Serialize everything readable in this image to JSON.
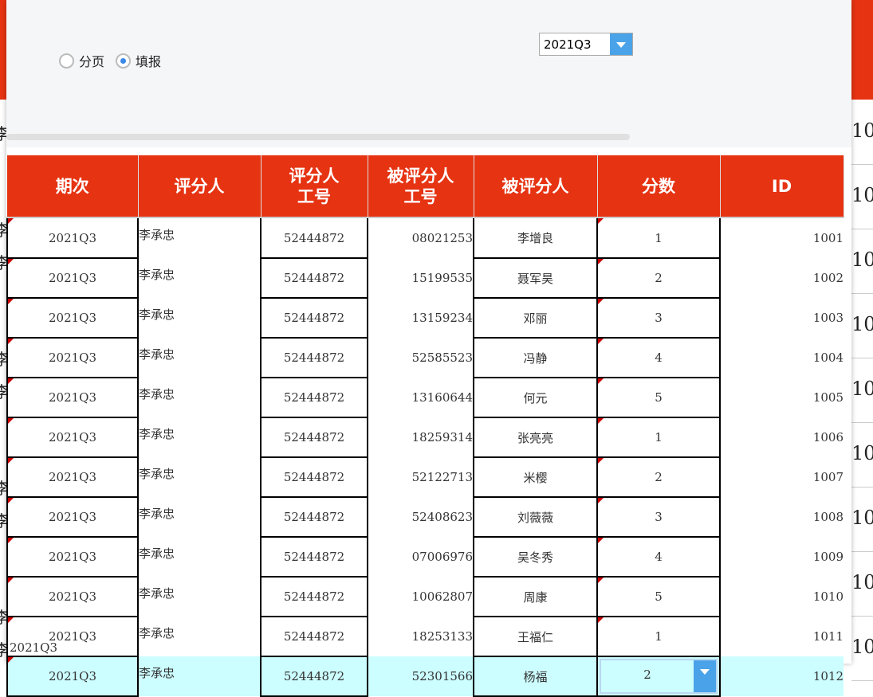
{
  "filters": {
    "radio_paging": "分页",
    "radio_fill": "填报",
    "selected": "fill",
    "period_select": "2021Q3"
  },
  "columns": [
    "期次",
    "评分人",
    "评分人\n工号",
    "被评分人\n工号",
    "被评分人",
    "分数",
    "ID"
  ],
  "rows": [
    [
      "2021Q3",
      "李承忠",
      "52444872",
      "08021253",
      "李增良",
      "1",
      "1001"
    ],
    [
      "2021Q3",
      "李承忠",
      "52444872",
      "15199535",
      "聂军昊",
      "2",
      "1002"
    ],
    [
      "2021Q3",
      "李承忠",
      "52444872",
      "13159234",
      "邓丽",
      "3",
      "1003"
    ],
    [
      "2021Q3",
      "李承忠",
      "52444872",
      "52585523",
      "冯静",
      "4",
      "1004"
    ],
    [
      "2021Q3",
      "李承忠",
      "52444872",
      "13160644",
      "何元",
      "5",
      "1005"
    ],
    [
      "2021Q3",
      "李承忠",
      "52444872",
      "18259314",
      "张亮亮",
      "1",
      "1006"
    ],
    [
      "2021Q3",
      "李承忠",
      "52444872",
      "52122713",
      "米樱",
      "2",
      "1007"
    ],
    [
      "2021Q3",
      "李承忠",
      "52444872",
      "52408623",
      "刘薇薇",
      "3",
      "1008"
    ],
    [
      "2021Q3",
      "李承忠",
      "52444872",
      "07006976",
      "吴冬秀",
      "4",
      "1009"
    ],
    [
      "2021Q3",
      "李承忠",
      "52444872",
      "10062807",
      "周康",
      "5",
      "1010"
    ],
    [
      "2021Q3",
      "李承忠",
      "52444872",
      "18253133",
      "王福仁",
      "1",
      "1011"
    ],
    [
      "2021Q3",
      "李承忠",
      "52444872",
      "52301566",
      "杨福",
      "2",
      "1012"
    ]
  ],
  "footer": "2021Q3",
  "background": {
    "left_char": "李",
    "right_num": "10"
  },
  "colors": {
    "header": "#e63312",
    "highlight": "#ccfdff",
    "accent": "#4aa3e8"
  }
}
